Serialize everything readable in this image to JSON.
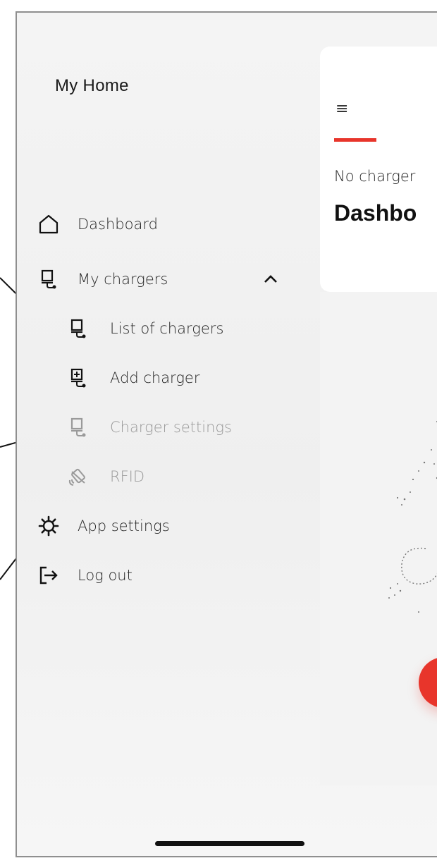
{
  "drawer": {
    "title": "My Home",
    "items": [
      {
        "label": "Dashboard",
        "icon": "house-icon"
      },
      {
        "label": "My chargers",
        "icon": "charger-icon"
      },
      {
        "label": "List of chargers",
        "icon": "charger-icon"
      },
      {
        "label": "Add charger",
        "icon": "add-charger-icon"
      },
      {
        "label": "Charger settings",
        "icon": "charger-icon"
      },
      {
        "label": "RFID",
        "icon": "rfid-icon"
      },
      {
        "label": "App settings",
        "icon": "gear-icon"
      },
      {
        "label": "Log out",
        "icon": "logout-icon"
      }
    ]
  },
  "content": {
    "menu_glyph": "≡",
    "subtitle": "No charger",
    "title": "Dashbo"
  },
  "colors": {
    "accent": "#e8352b",
    "text": "#262626",
    "disabled": "#9a9a9a"
  }
}
